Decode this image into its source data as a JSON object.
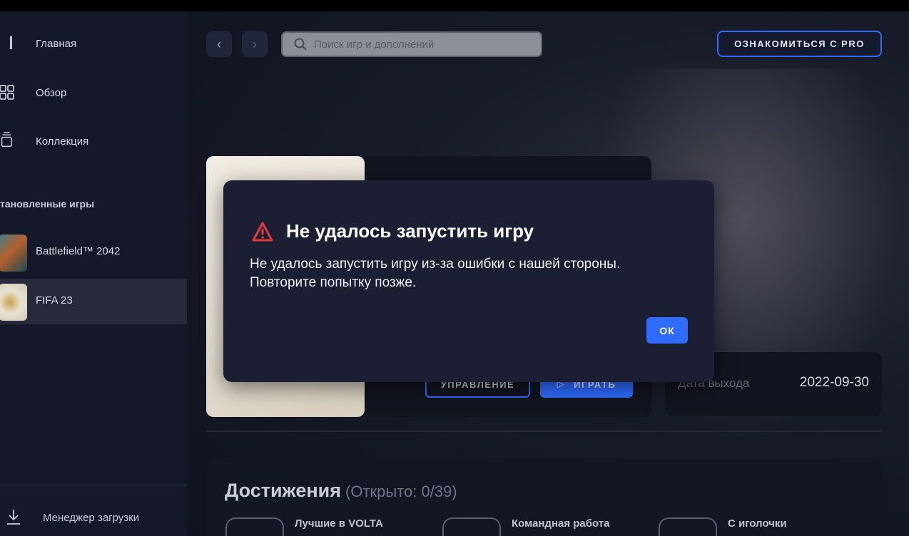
{
  "sidebar": {
    "nav": [
      {
        "label": "Главная",
        "icon": "home-icon"
      },
      {
        "label": "Обзор",
        "icon": "browse-grid-icon"
      },
      {
        "label": "Коллекция",
        "icon": "collection-icon"
      }
    ],
    "installed_title": "тановленные игры",
    "games": [
      {
        "label": "Battlefield™ 2042"
      },
      {
        "label": "FIFA 23",
        "active": true
      }
    ],
    "download_manager": "Менеджер загрузки"
  },
  "header": {
    "search_placeholder": "Поиск игр и дополнений",
    "pro_button": "ОЗНАКОМИТЬСЯ С PRO"
  },
  "game_page": {
    "manage_button": "УПРАВЛЕНИЕ",
    "play_button": "ИГРАТЬ",
    "release_label": "Дата выхода",
    "release_date": "2022-09-30"
  },
  "achievements": {
    "title": "Достижения",
    "count": "(Открыто: 0/39)",
    "items": [
      {
        "name": "Лучшие в VOLTA"
      },
      {
        "name": "Командная работа"
      },
      {
        "name": "С иголочки"
      }
    ]
  },
  "modal": {
    "title": "Не удалось запустить игру",
    "line1": "Не удалось запустить игру из-за ошибки с нашей стороны.",
    "line2": "Повторите попытку позже.",
    "ok": "ОК"
  },
  "colors": {
    "accent": "#2f6bff",
    "warning": "#e5383b",
    "modal_bg": "#1c1f33",
    "sidebar_bg": "#151829"
  }
}
